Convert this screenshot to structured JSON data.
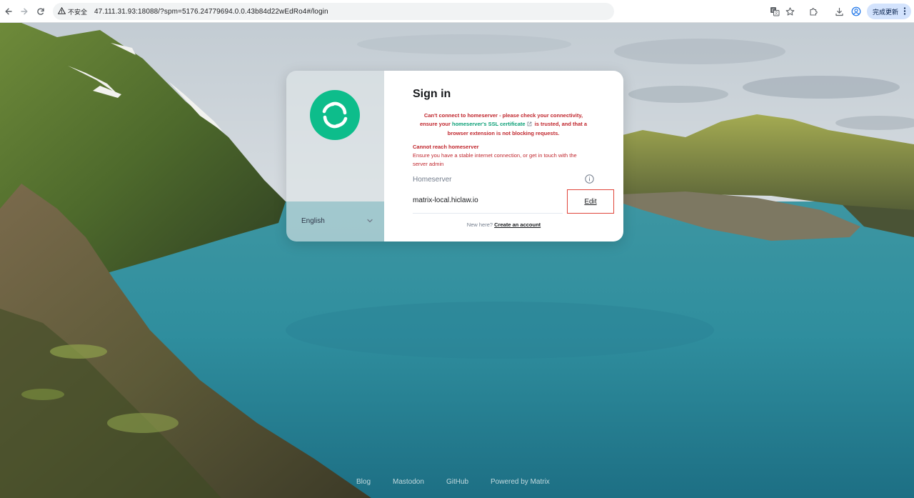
{
  "browser": {
    "security_label": "不安全",
    "url": "47.111.31.93:18088/?spm=5176.24779694.0.0.43b84d22wEdRo4#/login",
    "update_button": "完成更新",
    "icons": [
      "back-icon",
      "forward-icon",
      "reload-icon",
      "warning-icon",
      "translate-icon",
      "star-icon",
      "extensions-icon",
      "download-icon",
      "profile-icon",
      "more-icon"
    ]
  },
  "sidebar": {
    "language": "English"
  },
  "login": {
    "title": "Sign in",
    "error_line1": "Can't connect to homeserver - please check your connectivity,",
    "error_line2_prefix": "ensure your ",
    "error_line2_link": "homeserver's SSL certificate",
    "error_line2_suffix": " is trusted, and that a",
    "error_line3": "browser extension is not blocking requests.",
    "unreachable_title": "Cannot reach homeserver",
    "unreachable_desc": "Ensure you have a stable internet connection, or get in touch with the server admin",
    "homeserver_label": "Homeserver",
    "homeserver_value": "matrix-local.hiclaw.io",
    "edit_label": "Edit",
    "new_here_prefix": "New here? ",
    "create_account": "Create an account"
  },
  "footer": {
    "blog": "Blog",
    "mastodon": "Mastodon",
    "github": "GitHub",
    "powered": "Powered by Matrix"
  },
  "colors": {
    "accent": "#0dbd8b",
    "error": "#c0262d",
    "edit_highlight": "#e0453a"
  }
}
